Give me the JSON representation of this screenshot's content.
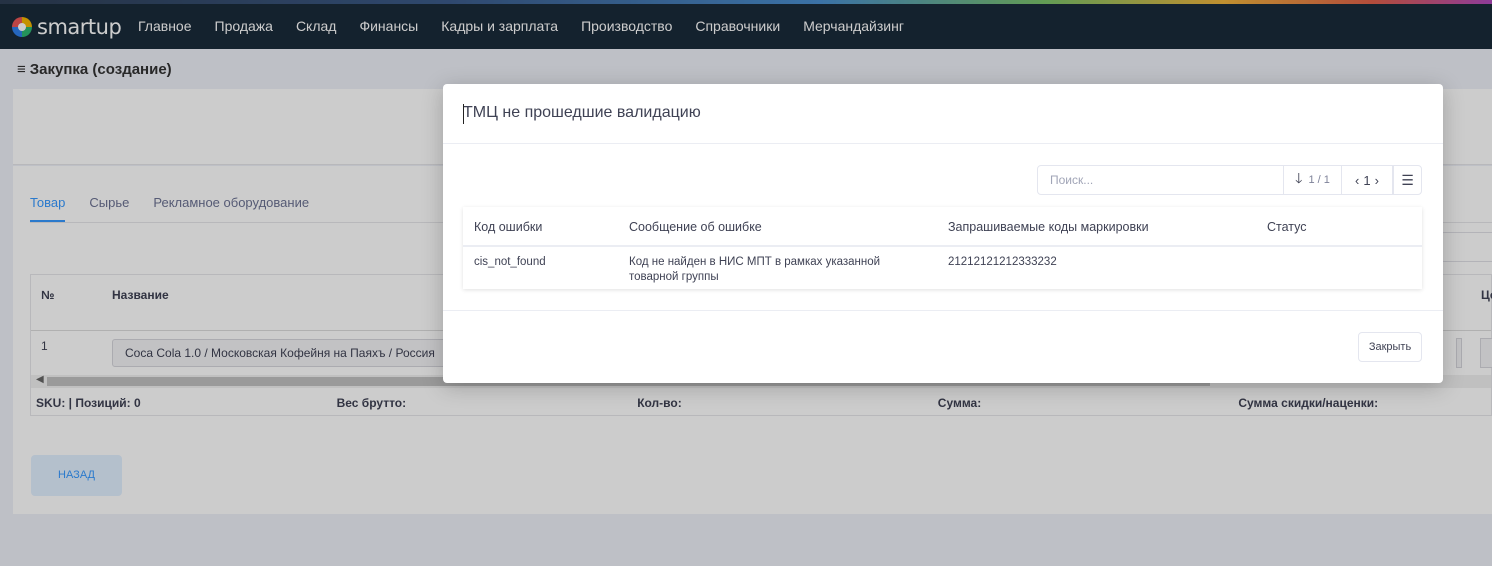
{
  "app": {
    "logo_text": "smartup"
  },
  "nav": {
    "items": [
      "Главное",
      "Продажа",
      "Склад",
      "Финансы",
      "Кадры и зарплата",
      "Производство",
      "Справочники",
      "Мерчандайзинг"
    ]
  },
  "page": {
    "menu_glyph": "≡",
    "title": "Закупка (создание)"
  },
  "tabs": [
    "Товар",
    "Сырье",
    "Рекламное оборудование"
  ],
  "grid": {
    "headers": {
      "num": "№",
      "name": "Название",
      "price": "Це"
    },
    "row": {
      "num": "1",
      "name": "Coca Cola 1.0 / Московская Кофейня на Паяхъ / Россия"
    },
    "footer": [
      "SKU: | Позиций: 0",
      "Вес брутто:",
      "Кол-во:",
      "Сумма:",
      "Сумма скидки/наценки:"
    ]
  },
  "back_button": "НАЗАД",
  "modal": {
    "title": "ТМЦ не прошедшие валидацию",
    "search_placeholder": "Поиск...",
    "pager_text": "1 / 1",
    "page_number": "1",
    "columns": [
      "Код ошибки",
      "Сообщение об ошибке",
      "Запрашиваемые коды маркировки",
      "Статус"
    ],
    "rows": [
      {
        "code": "cis_not_found",
        "message": "Код не найден в НИС МПТ в рамках указанной товарной группы",
        "marking_codes": "21212121212333232",
        "status": ""
      }
    ],
    "close_button": "Закрыть"
  },
  "colors": {
    "accent": "#3699ff",
    "topbar": "#1a2b3a"
  }
}
